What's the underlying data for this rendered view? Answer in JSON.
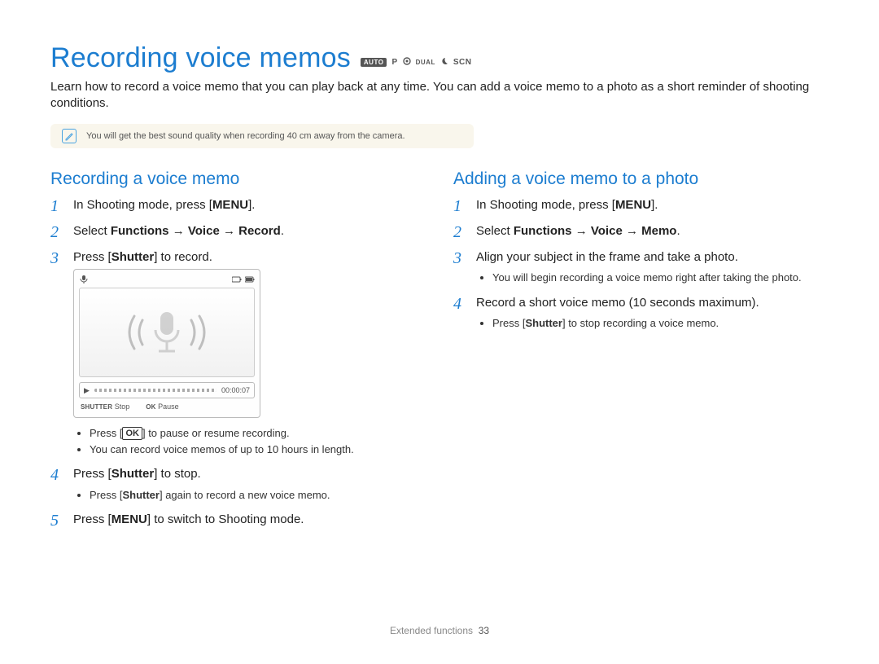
{
  "header": {
    "title": "Recording voice memos",
    "modes": {
      "auto": "AUTO",
      "p": "P",
      "dual": "DUAL",
      "scn": "SCN"
    }
  },
  "intro": "Learn how to record a voice memo that you can play back at any time. You can add a voice memo to a photo as a short reminder of shooting conditions.",
  "tip": {
    "text": "You will get the best sound quality when recording 40 cm away from the camera."
  },
  "left": {
    "heading": "Recording a voice memo",
    "step1_a": "In Shooting mode, press [",
    "step1_menu": "MENU",
    "step1_b": "].",
    "step2_a": "Select ",
    "step2_b": "Functions",
    "step2_c": " → ",
    "step2_d": "Voice",
    "step2_e": " → ",
    "step2_f": "Record",
    "step2_g": ".",
    "step3_a": "Press [",
    "step3_b": "Shutter",
    "step3_c": "] to record.",
    "screen": {
      "time": "00:00:07",
      "stop": "Stop",
      "pause": "Pause",
      "shutter_label": "SHUTTER",
      "ok_label": "OK"
    },
    "step3_sub1_a": "Press [",
    "step3_sub1_ok": "OK",
    "step3_sub1_b": "] to pause or resume recording.",
    "step3_sub2": "You can record voice memos of up to 10 hours in length.",
    "step4_a": "Press [",
    "step4_b": "Shutter",
    "step4_c": "] to stop.",
    "step4_sub_a": "Press [",
    "step4_sub_b": "Shutter",
    "step4_sub_c": "] again to record a new voice memo.",
    "step5_a": "Press [",
    "step5_menu": "MENU",
    "step5_b": "] to switch to Shooting mode."
  },
  "right": {
    "heading": "Adding a voice memo to a photo",
    "step1_a": "In Shooting mode, press [",
    "step1_menu": "MENU",
    "step1_b": "].",
    "step2_a": "Select ",
    "step2_b": "Functions",
    "step2_c": " → ",
    "step2_d": "Voice",
    "step2_e": " → ",
    "step2_f": "Memo",
    "step2_g": ".",
    "step3": "Align your subject in the frame and take a photo.",
    "step3_sub": "You will begin recording a voice memo right after taking the photo.",
    "step4": "Record a short voice memo (10 seconds maximum).",
    "step4_sub_a": "Press [",
    "step4_sub_b": "Shutter",
    "step4_sub_c": "] to stop recording a voice memo."
  },
  "footer": {
    "section": "Extended functions",
    "page": "33"
  }
}
